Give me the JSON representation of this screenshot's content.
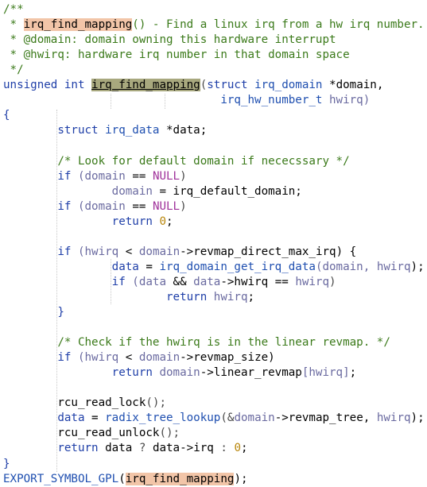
{
  "editor": {
    "language": "c",
    "lines": [
      [
        {
          "t": "/**",
          "k": "c"
        }
      ],
      [
        {
          "t": " * ",
          "k": "c"
        },
        {
          "t": "irq_find_mapping",
          "k": "hl"
        },
        {
          "t": "() - Find a linux irq from a hw irq number.",
          "k": "c"
        }
      ],
      [
        {
          "t": " * @domain: domain owning this hardware interrupt",
          "k": "c"
        }
      ],
      [
        {
          "t": " * @hwirq: hardware irq number in that domain space",
          "k": "c"
        }
      ],
      [
        {
          "t": " */",
          "k": "c"
        }
      ],
      [
        {
          "t": "unsigned int ",
          "k": "kw"
        },
        {
          "t": "irq_find_mapping",
          "k": "fhl"
        },
        {
          "t": "(",
          "k": "op"
        },
        {
          "t": "struct ",
          "k": "kw"
        },
        {
          "t": "irq_domain",
          "k": "ty"
        },
        {
          "t": " *domain,",
          "k": ""
        }
      ],
      [
        {
          "t": "                                ",
          "k": ""
        },
        {
          "t": "irq_hw_number_t",
          "k": "ty"
        },
        {
          "t": " hwirq)",
          "k": "v"
        }
      ],
      [
        {
          "t": "{",
          "k": "kw"
        }
      ],
      [
        {
          "t": "        struct ",
          "k": "kw"
        },
        {
          "t": "irq_data",
          "k": "ty"
        },
        {
          "t": " *data;",
          "k": ""
        }
      ],
      [
        {
          "t": "",
          "k": ""
        }
      ],
      [
        {
          "t": "        /* Look for default domain if nececssary */",
          "k": "c"
        }
      ],
      [
        {
          "t": "        if ",
          "k": "kw"
        },
        {
          "t": "(domain ",
          "k": "v"
        },
        {
          "t": "== ",
          "k": ""
        },
        {
          "t": "NULL",
          "k": "nul"
        },
        {
          "t": ")",
          "k": "op"
        }
      ],
      [
        {
          "t": "                domain ",
          "k": "v"
        },
        {
          "t": "= irq_default_domain;",
          "k": ""
        }
      ],
      [
        {
          "t": "        if ",
          "k": "kw"
        },
        {
          "t": "(domain ",
          "k": "v"
        },
        {
          "t": "== ",
          "k": ""
        },
        {
          "t": "NULL",
          "k": "nul"
        },
        {
          "t": ")",
          "k": "op"
        }
      ],
      [
        {
          "t": "                return ",
          "k": "kw"
        },
        {
          "t": "0",
          "k": "num"
        },
        {
          "t": ";",
          "k": ""
        }
      ],
      [
        {
          "t": "",
          "k": ""
        }
      ],
      [
        {
          "t": "        if ",
          "k": "kw"
        },
        {
          "t": "(hwirq ",
          "k": "v"
        },
        {
          "t": "< ",
          "k": ""
        },
        {
          "t": "domain",
          "k": "v"
        },
        {
          "t": "->revmap_direct_max_irq) {",
          "k": ""
        }
      ],
      [
        {
          "t": "                data ",
          "k": "kw"
        },
        {
          "t": "= ",
          "k": ""
        },
        {
          "t": "irq_domain_get_irq_data",
          "k": "ty"
        },
        {
          "t": "(domain, ",
          "k": "v"
        },
        {
          "t": "hwirq",
          "k": "v"
        },
        {
          "t": ");",
          "k": ""
        }
      ],
      [
        {
          "t": "                if ",
          "k": "kw"
        },
        {
          "t": "(data ",
          "k": "v"
        },
        {
          "t": "&& ",
          "k": ""
        },
        {
          "t": "data",
          "k": "v"
        },
        {
          "t": "->hwirq ",
          "k": ""
        },
        {
          "t": "== ",
          "k": ""
        },
        {
          "t": "hwirq",
          "k": "v"
        },
        {
          "t": ")",
          "k": "op"
        }
      ],
      [
        {
          "t": "                        return ",
          "k": "kw"
        },
        {
          "t": "hwirq",
          "k": "v"
        },
        {
          "t": ";",
          "k": ""
        }
      ],
      [
        {
          "t": "        }",
          "k": "kw"
        }
      ],
      [
        {
          "t": "",
          "k": ""
        }
      ],
      [
        {
          "t": "        /* Check if the hwirq is in the linear revmap. */",
          "k": "c"
        }
      ],
      [
        {
          "t": "        if ",
          "k": "kw"
        },
        {
          "t": "(hwirq ",
          "k": "v"
        },
        {
          "t": "< ",
          "k": ""
        },
        {
          "t": "domain",
          "k": "v"
        },
        {
          "t": "->revmap_size)",
          "k": ""
        }
      ],
      [
        {
          "t": "                return ",
          "k": "kw"
        },
        {
          "t": "domain",
          "k": "v"
        },
        {
          "t": "->linear_revmap",
          "k": ""
        },
        {
          "t": "[hwirq]",
          "k": "v"
        },
        {
          "t": ";",
          "k": ""
        }
      ],
      [
        {
          "t": "",
          "k": ""
        }
      ],
      [
        {
          "t": "        rcu_read_lock",
          "k": ""
        },
        {
          "t": "();",
          "k": "op"
        }
      ],
      [
        {
          "t": "        data ",
          "k": "kw"
        },
        {
          "t": "= ",
          "k": ""
        },
        {
          "t": "radix_tree_lookup",
          "k": "ty"
        },
        {
          "t": "(&",
          "k": "op"
        },
        {
          "t": "domain",
          "k": "v"
        },
        {
          "t": "->revmap_tree, ",
          "k": ""
        },
        {
          "t": "hwirq",
          "k": "v"
        },
        {
          "t": ");",
          "k": ""
        }
      ],
      [
        {
          "t": "        rcu_read_unlock",
          "k": ""
        },
        {
          "t": "();",
          "k": "op"
        }
      ],
      [
        {
          "t": "        return ",
          "k": "kw"
        },
        {
          "t": "data ",
          "k": ""
        },
        {
          "t": "? ",
          "k": "op"
        },
        {
          "t": "data",
          "k": ""
        },
        {
          "t": "->irq ",
          "k": ""
        },
        {
          "t": ": ",
          "k": "op"
        },
        {
          "t": "0",
          "k": "num"
        },
        {
          "t": ";",
          "k": ""
        }
      ],
      [
        {
          "t": "}",
          "k": "kw"
        }
      ],
      [
        {
          "t": "EXPORT_SYMBOL_GPL",
          "k": "ty"
        },
        {
          "t": "(",
          "k": ""
        },
        {
          "t": "irq_find_mapping",
          "k": "hl"
        },
        {
          "t": ");",
          "k": ""
        }
      ]
    ]
  },
  "colors": {
    "comment": "#3b7a1a",
    "keyword": "#1f3fa8",
    "type": "#1f4fb0",
    "null": "#a0329b",
    "number": "#b8860b",
    "search_highlight": "#f2c5a8",
    "cursor_highlight": "#a8a87e",
    "background": "#ffffff"
  }
}
